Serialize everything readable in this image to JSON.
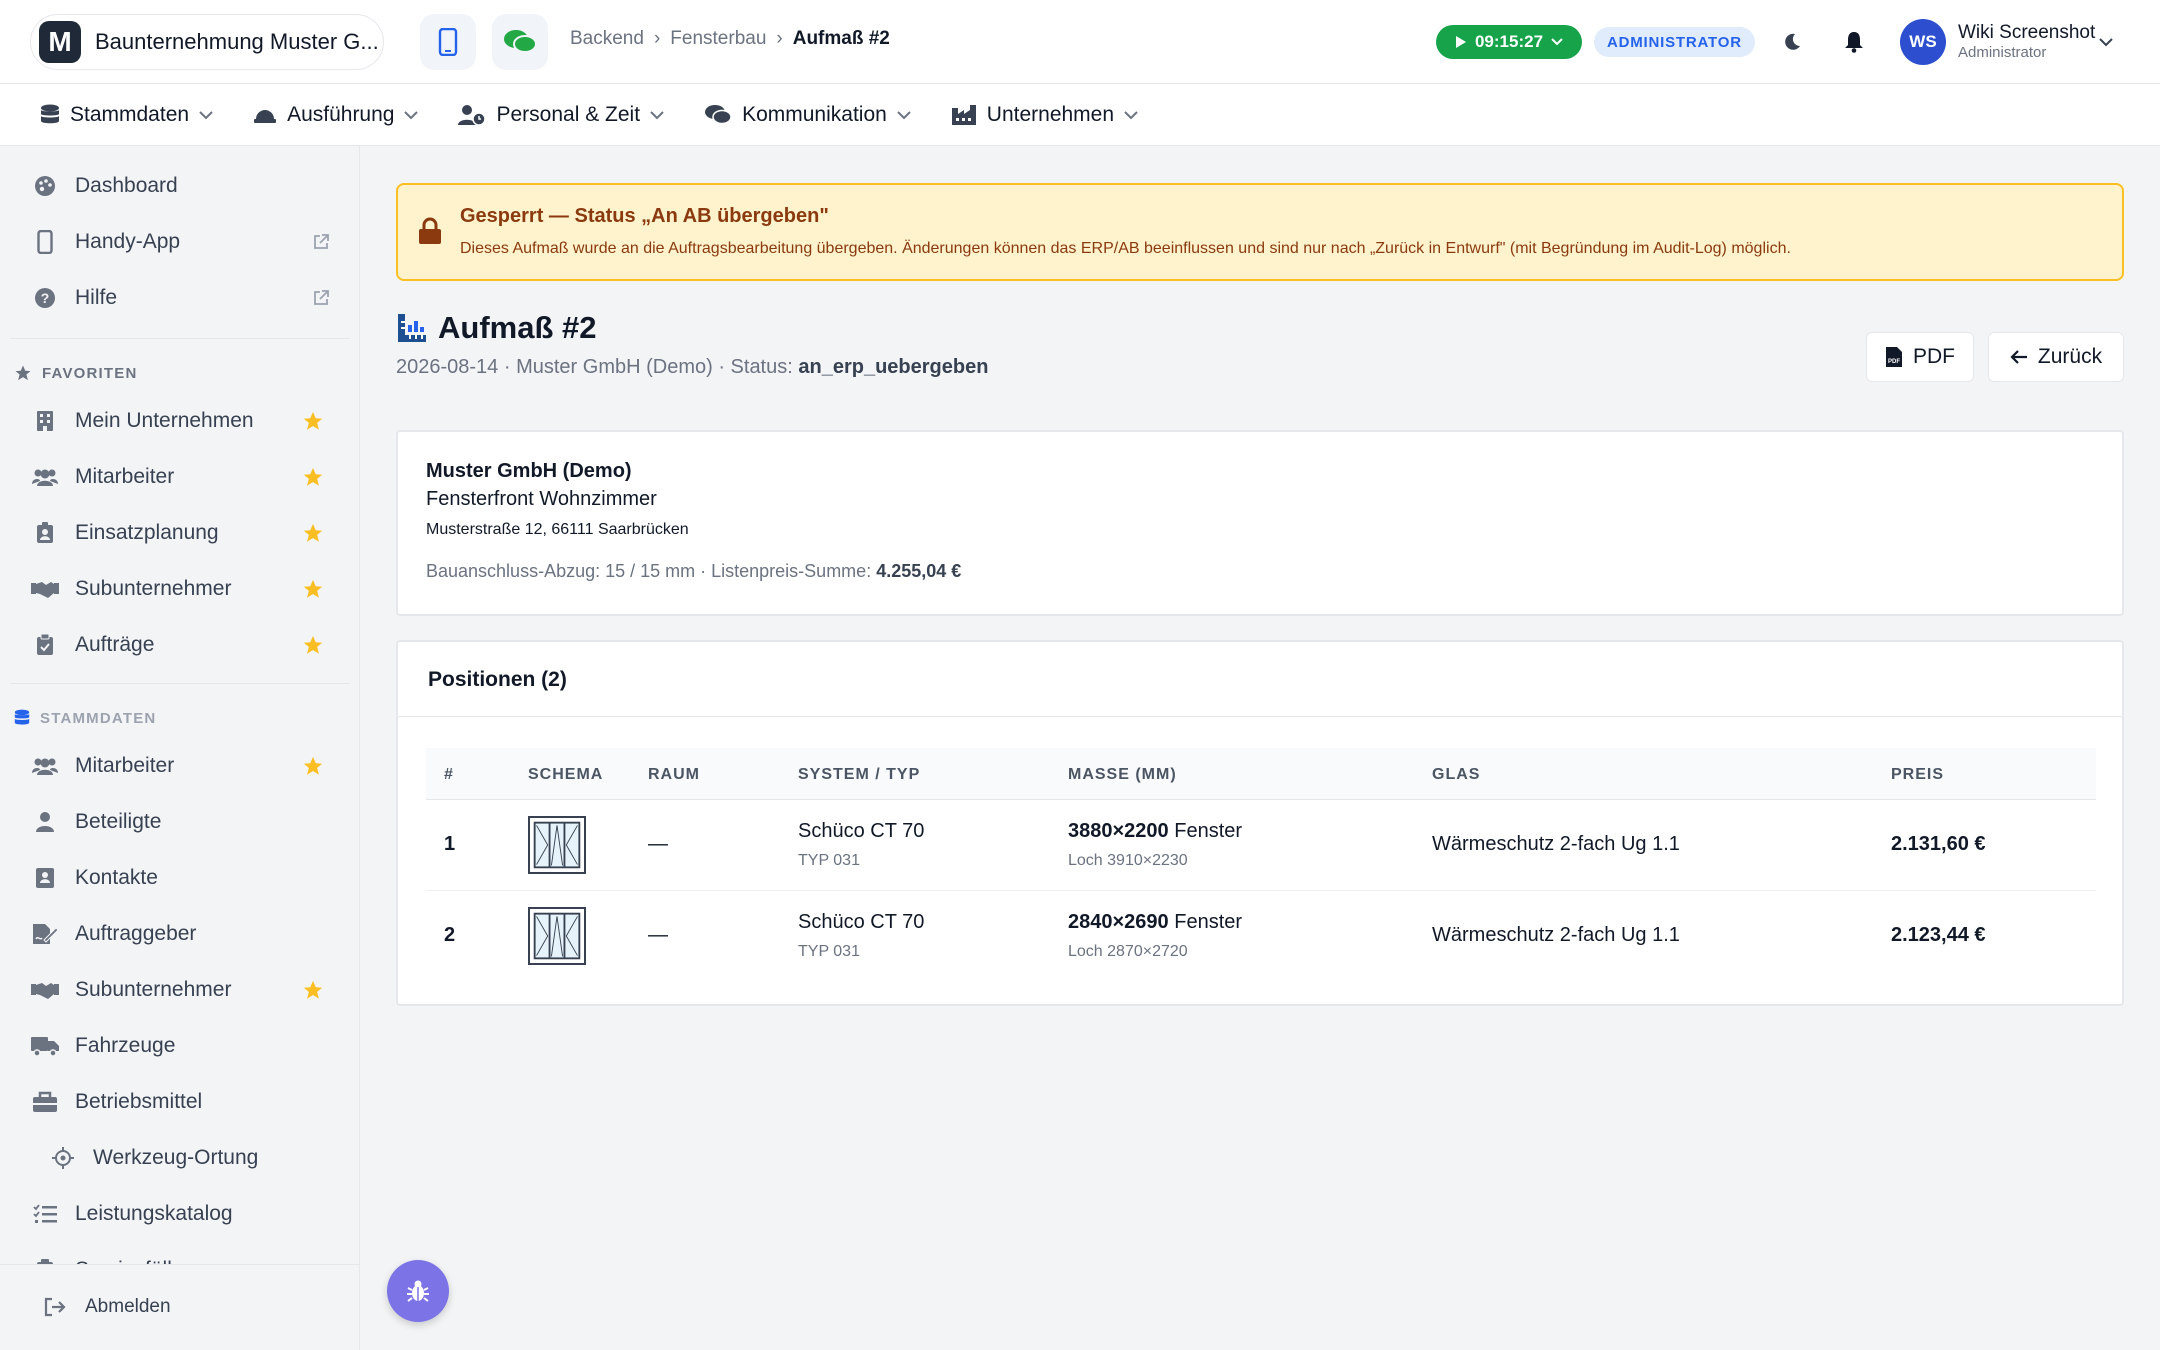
{
  "app": {
    "company_name": "Baunternehmung Muster G...",
    "logo_letter": "M"
  },
  "breadcrumb": [
    "Backend",
    "Fensterbau",
    "Aufmaß #2"
  ],
  "timer": "09:15:27",
  "role_badge": "ADMINISTRATOR",
  "user": {
    "initials": "WS",
    "name": "Wiki Screenshot",
    "role": "Administrator"
  },
  "nav": [
    {
      "label": "Stammdaten",
      "icon": "database-icon"
    },
    {
      "label": "Ausführung",
      "icon": "hardhat-icon"
    },
    {
      "label": "Personal & Zeit",
      "icon": "user-clock-icon"
    },
    {
      "label": "Kommunikation",
      "icon": "comments-icon"
    },
    {
      "label": "Unternehmen",
      "icon": "industry-icon"
    }
  ],
  "sidebar": {
    "top": [
      {
        "label": "Dashboard",
        "icon": "palette-icon"
      },
      {
        "label": "Handy-App",
        "icon": "mobile-icon",
        "external": true
      },
      {
        "label": "Hilfe",
        "icon": "help-icon",
        "external": true
      }
    ],
    "favorites_heading": "FAVORITEN",
    "favorites": [
      {
        "label": "Mein Unternehmen",
        "icon": "building-icon"
      },
      {
        "label": "Mitarbeiter",
        "icon": "users-icon"
      },
      {
        "label": "Einsatzplanung",
        "icon": "badge-icon"
      },
      {
        "label": "Subunternehmer",
        "icon": "handshake-icon"
      },
      {
        "label": "Aufträge",
        "icon": "clipboard-check-icon"
      }
    ],
    "stammdaten_heading": "STAMMDATEN",
    "stammdaten": [
      {
        "label": "Mitarbeiter",
        "icon": "users-icon",
        "star": true
      },
      {
        "label": "Beteiligte",
        "icon": "user-icon",
        "star": false
      },
      {
        "label": "Kontakte",
        "icon": "address-card-icon",
        "star": false
      },
      {
        "label": "Auftraggeber",
        "icon": "file-signature-icon",
        "star": false
      },
      {
        "label": "Subunternehmer",
        "icon": "handshake-icon",
        "star": true
      },
      {
        "label": "Fahrzeuge",
        "icon": "truck-icon",
        "star": false
      },
      {
        "label": "Betriebsmittel",
        "icon": "toolbox-icon",
        "star": false
      },
      {
        "label": "Werkzeug-Ortung",
        "icon": "crosshairs-icon",
        "star": false,
        "indent": true
      },
      {
        "label": "Leistungskatalog",
        "icon": "list-check-icon",
        "star": false
      },
      {
        "label": "Servicefälle",
        "icon": "clipboard-icon",
        "star": false
      }
    ],
    "logout": "Abmelden"
  },
  "alert": {
    "title": "Gesperrt — Status „An AB übergeben\"",
    "text": "Dieses Aufmaß wurde an die Auftragsbearbeitung übergeben. Änderungen können das ERP/AB beeinflussen und sind nur nach „Zurück in Entwurf\" (mit Begründung im Audit-Log) möglich."
  },
  "page": {
    "title": "Aufmaß #2",
    "subtitle_prefix": "2026-08-14 · Muster GmbH (Demo) · Status: ",
    "status": "an_erp_uebergeben",
    "pdf_label": "PDF",
    "back_label": "Zurück"
  },
  "info": {
    "customer": "Muster GmbH (Demo)",
    "project": "Fensterfront Wohnzimmer",
    "address": "Musterstraße 12, 66111 Saarbrücken",
    "meta_prefix": "Bauanschluss-Abzug: 15 / 15 mm · Listenpreis-Summe: ",
    "sum": "4.255,04 €"
  },
  "positions": {
    "title": "Positionen (2)",
    "headers": [
      "#",
      "SCHEMA",
      "RAUM",
      "SYSTEM / TYP",
      "MASSE (MM)",
      "GLAS",
      "PREIS"
    ],
    "rows": [
      {
        "nr": "1",
        "raum": "—",
        "system": "Schüco CT 70",
        "typ": "TYP 031",
        "masse": "3880×2200",
        "art": "Fenster",
        "loch": "Loch 3910×2230",
        "glas": "Wärmeschutz 2-fach Ug 1.1",
        "preis": "2.131,60 €"
      },
      {
        "nr": "2",
        "raum": "—",
        "system": "Schüco CT 70",
        "typ": "TYP 031",
        "masse": "2840×2690",
        "art": "Fenster",
        "loch": "Loch 2870×2720",
        "glas": "Wärmeschutz 2-fach Ug 1.1",
        "preis": "2.123,44 €"
      }
    ]
  },
  "colors": {
    "accent": "#2563eb",
    "timer": "#16a34a",
    "alert_bg": "#fff3cd",
    "alert_border": "#fbbf24",
    "star": "#fbbf24",
    "fab": "#7c73e6"
  }
}
